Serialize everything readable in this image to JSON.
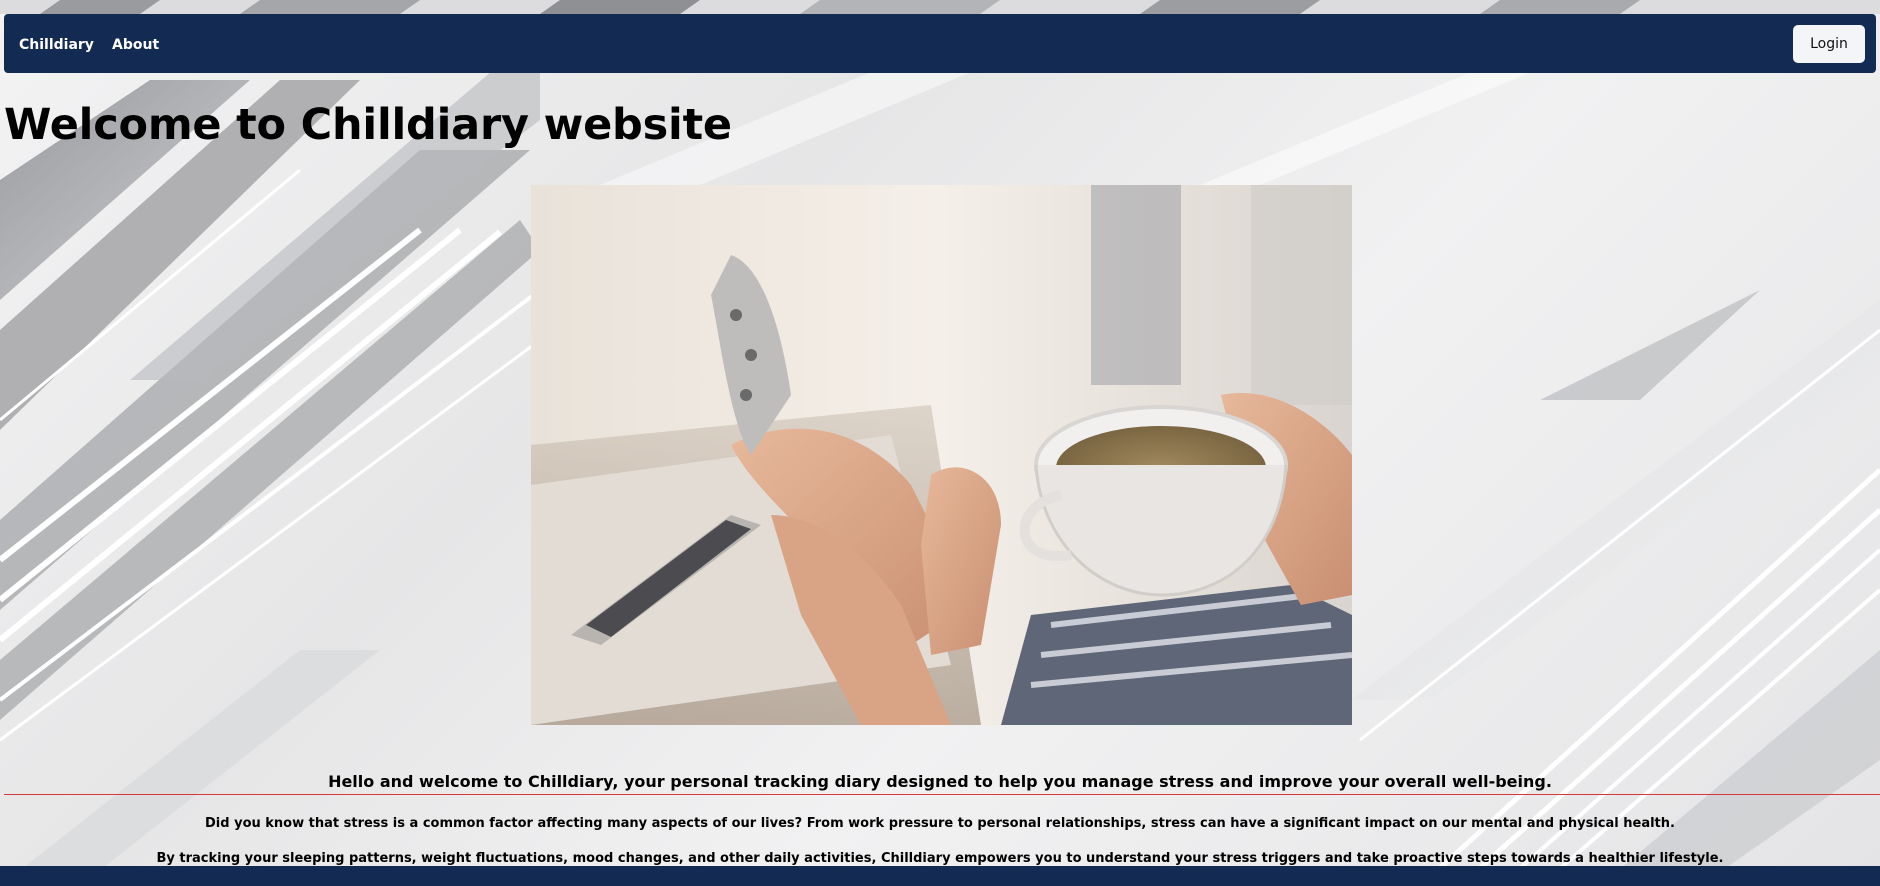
{
  "navbar": {
    "brand": "Chilldiary",
    "about": "About",
    "login": "Login"
  },
  "main": {
    "title": "Welcome to Chilldiary website",
    "hero_image_alt": "Person relaxing with a cup of tea",
    "intro": "Hello and welcome to Chilldiary, your personal tracking diary designed to help you manage stress and improve your overall well-being.",
    "paragraph1": "Did you know that stress is a common factor affecting many aspects of our lives? From work pressure to personal relationships, stress can have a significant impact on our mental and physical health.",
    "paragraph2": "By tracking your sleeping patterns, weight fluctuations, mood changes, and other daily activities, Chilldiary empowers you to understand your stress triggers and take proactive steps towards a healthier lifestyle."
  },
  "colors": {
    "navbar": "#132a52",
    "accent_rule": "#d33a3a",
    "button_bg": "#f4f5f7"
  }
}
